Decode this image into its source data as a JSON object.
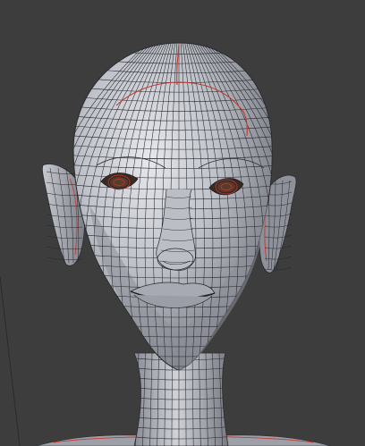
{
  "app": {
    "viewport_background": "#3d3d3d",
    "mesh_fill": "#b9bcc3",
    "mesh_shadow": "#6e7079",
    "wire_color": "#23242a",
    "seam_color": "#c23a30"
  }
}
